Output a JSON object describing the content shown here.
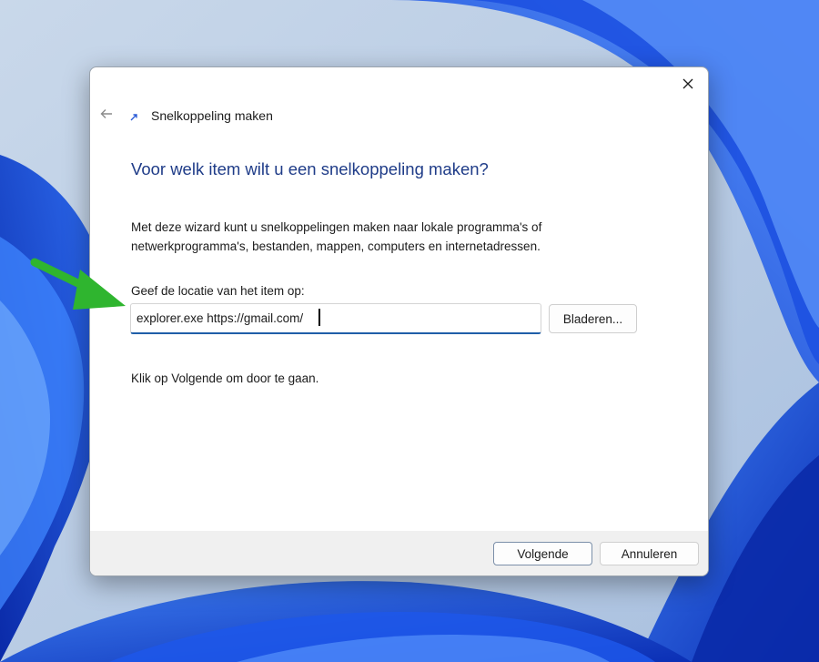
{
  "dialog": {
    "window_title": "Snelkoppeling maken",
    "heading": "Voor welk item wilt u een snelkoppeling maken?",
    "description": "Met deze wizard kunt u snelkoppelingen maken naar lokale programma's of netwerkprogramma's, bestanden, mappen, computers en internetadressen.",
    "location_label": "Geef de locatie van het item op:",
    "location_value": "explorer.exe https://gmail.com/",
    "browse_label": "Bladeren...",
    "hint": "Klik op Volgende om door te gaan.",
    "next_label": "Volgende",
    "cancel_label": "Annuleren"
  },
  "icons": {
    "close": "close-icon",
    "back": "back-arrow-icon",
    "shortcut": "shortcut-icon",
    "annotation": "green-arrow-annotation"
  },
  "colors": {
    "heading": "#1f3c88",
    "input_focus": "#1f5ea8",
    "annotation_arrow": "#2fb52f",
    "wallpaper_blue": "#1346d6"
  }
}
